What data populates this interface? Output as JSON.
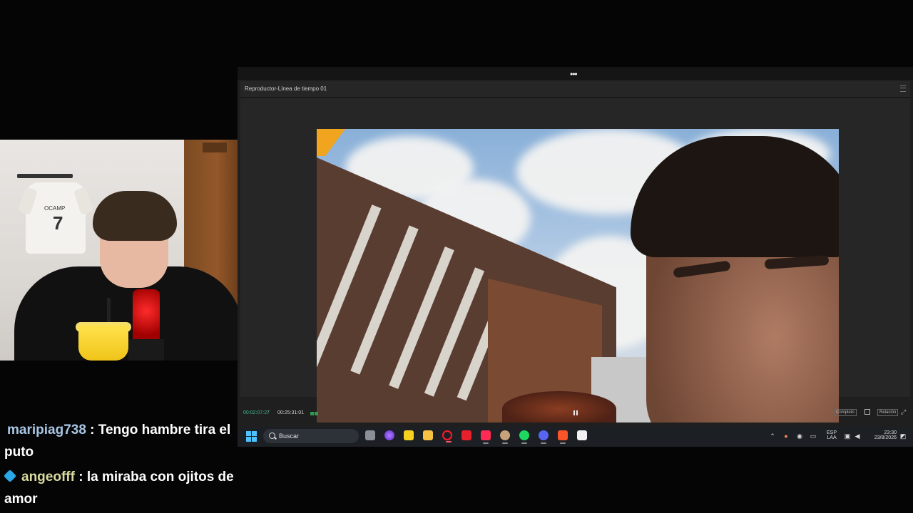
{
  "chat": {
    "messages": [
      {
        "user": "maripiag738",
        "sep": " : ",
        "text": "Tengo hambre tira el puto"
      },
      {
        "user": "angeofff",
        "sep": " : ",
        "text": "la miraba con ojitos de amor"
      }
    ]
  },
  "jersey": {
    "name": "OCAMP",
    "number": "7"
  },
  "editor": {
    "dots": "•••",
    "panel_title": "Reproductor-Línea de tiempo 01",
    "timecode_current": "00:02:07:27",
    "timecode_sep": "/",
    "timecode_duration": "00:25:31:01",
    "btn_left": "Completo",
    "btn_right": "Relación"
  },
  "taskbar": {
    "search_label": "Buscar",
    "tray": {
      "lang_top": "ESP",
      "lang_bottom": "LAA",
      "time": "23:30",
      "date": "23/8/2026"
    }
  },
  "colors": {
    "accent_timecode": "#3fb58e",
    "taskbar_bg": "#1c1f24",
    "windows_blue": "#4cc2ff"
  },
  "icons": [
    "windows-start-icon",
    "search-icon",
    "task-view-icon",
    "copilot-icon",
    "sticky-notes-icon",
    "file-explorer-icon",
    "opera-icon",
    "wps-icon",
    "tiktok-icon",
    "avatar-app-icon",
    "spotify-icon",
    "discord-icon",
    "brave-icon",
    "capcut-icon",
    "chevron-up-icon",
    "microphone-icon",
    "network-icon",
    "keyboard-icon",
    "display-icon",
    "volume-icon",
    "notification-icon"
  ]
}
